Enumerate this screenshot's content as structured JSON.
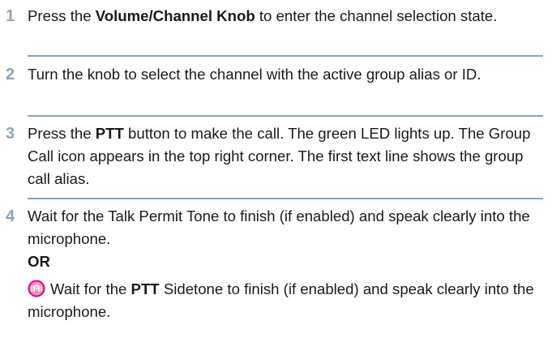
{
  "steps": [
    {
      "number": "1",
      "pre": "Press the ",
      "bold": "Volume/Channel Knob",
      "post": " to enter the channel selection state."
    },
    {
      "number": "2",
      "text": "Turn the knob to select the channel with the active group alias or ID."
    },
    {
      "number": "3",
      "pre": "Press the ",
      "bold": "PTT",
      "post": " button to make the call. The green LED lights up. The Group Call icon appears in the top right corner. The first text line shows the group call alias."
    },
    {
      "number": "4",
      "text": "Wait for the Talk Permit Tone to finish (if enabled) and speak clearly into the microphone.",
      "or_label": "OR",
      "alt_pre": "Wait for the ",
      "alt_bold": "PTT",
      "alt_post": " Sidetone to finish (if enabled) and speak clearly into the microphone.",
      "alt_icon": "sidetone-icon"
    }
  ],
  "colors": {
    "step_number": "#8fa2b8",
    "rule": "#8fa2b8",
    "text": "#1a1a1a",
    "icon_outer": "#e5007e",
    "icon_inner": "#f7a8d0"
  }
}
